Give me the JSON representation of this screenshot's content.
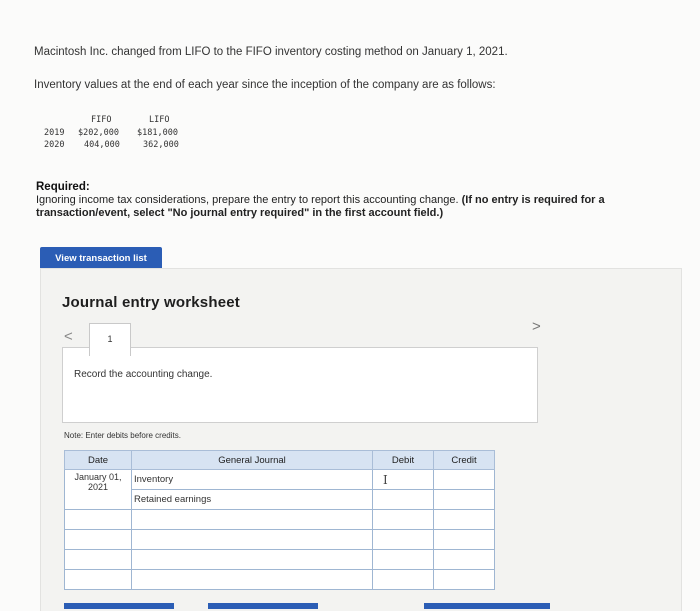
{
  "problem": {
    "intro1": "Macintosh Inc. changed from LIFO to the FIFO inventory costing method on January 1, 2021.",
    "intro2": "Inventory values at the end of each year since the inception of the company are as follows:",
    "inventory_table": {
      "headers": [
        "FIFO",
        "LIFO"
      ],
      "rows": [
        {
          "year": "2019",
          "fifo": "$202,000",
          "lifo": "$181,000"
        },
        {
          "year": "2020",
          "fifo": "404,000",
          "lifo": "362,000"
        }
      ]
    },
    "required_heading": "Required:",
    "required_text": "Ignoring income tax considerations, prepare the entry to report this accounting change.",
    "required_bold": "(If no entry is required for a transaction/event, select \"No journal entry required\" in the first account field.)"
  },
  "buttons": {
    "view_transactions": "View transaction list"
  },
  "worksheet": {
    "title": "Journal entry worksheet",
    "page_number": "1",
    "nav_prev": "<",
    "nav_next": ">",
    "instruction": "Record the accounting change.",
    "note": "Note: Enter debits before credits.",
    "columns": [
      "Date",
      "General Journal",
      "Debit",
      "Credit"
    ],
    "rows": [
      {
        "date": "January 01, 2021",
        "account": "Inventory",
        "debit": "",
        "credit": ""
      },
      {
        "date": "",
        "account": "Retained earnings",
        "debit": "",
        "credit": ""
      },
      {
        "date": "",
        "account": "",
        "debit": "",
        "credit": ""
      },
      {
        "date": "",
        "account": "",
        "debit": "",
        "credit": ""
      },
      {
        "date": "",
        "account": "",
        "debit": "",
        "credit": ""
      },
      {
        "date": "",
        "account": "",
        "debit": "",
        "credit": ""
      }
    ],
    "text_cursor": "I"
  },
  "colors": {
    "button_blue": "#2b5db5",
    "table_header": "#d7e3f2"
  }
}
